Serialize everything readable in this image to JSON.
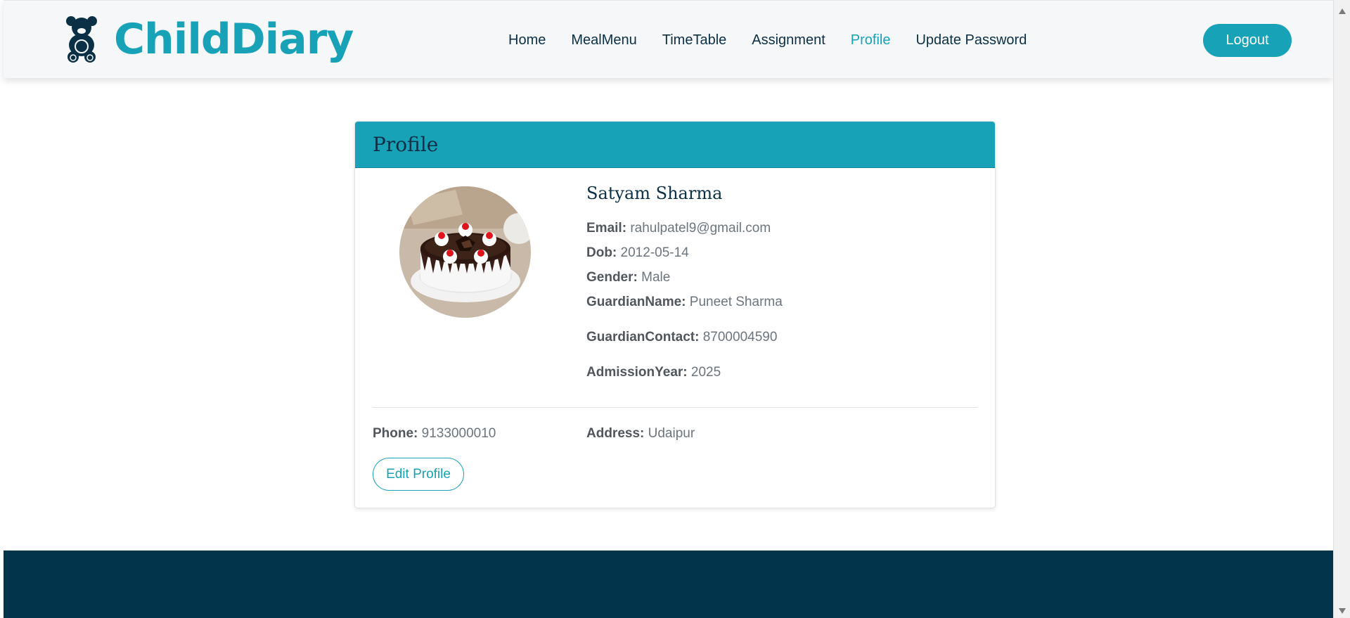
{
  "brand": {
    "name": "ChildDiary",
    "icon": "teddy-bear-icon"
  },
  "nav": {
    "items": [
      {
        "label": "Home",
        "active": false
      },
      {
        "label": "MealMenu",
        "active": false
      },
      {
        "label": "TimeTable",
        "active": false
      },
      {
        "label": "Assignment",
        "active": false
      },
      {
        "label": "Profile",
        "active": true
      },
      {
        "label": "Update Password",
        "active": false
      }
    ],
    "logout_label": "Logout"
  },
  "card": {
    "title": "Profile",
    "name": "Satyam Sharma",
    "fields": {
      "email_label": "Email:",
      "email": "rahulpatel9@gmail.com",
      "dob_label": "Dob:",
      "dob": "2012-05-14",
      "gender_label": "Gender:",
      "gender": "Male",
      "guardian_name_label": "GuardianName:",
      "guardian_name": "Puneet Sharma",
      "guardian_contact_label": "GuardianContact:",
      "guardian_contact": "8700004590",
      "admission_year_label": "AdmissionYear:",
      "admission_year": "2025"
    },
    "phone_label": "Phone:",
    "phone": "9133000010",
    "address_label": "Address:",
    "address": "Udaipur",
    "edit_label": "Edit Profile"
  },
  "colors": {
    "accent": "#17a2b8",
    "navy": "#02344b",
    "text_dark": "#0b2f45"
  }
}
